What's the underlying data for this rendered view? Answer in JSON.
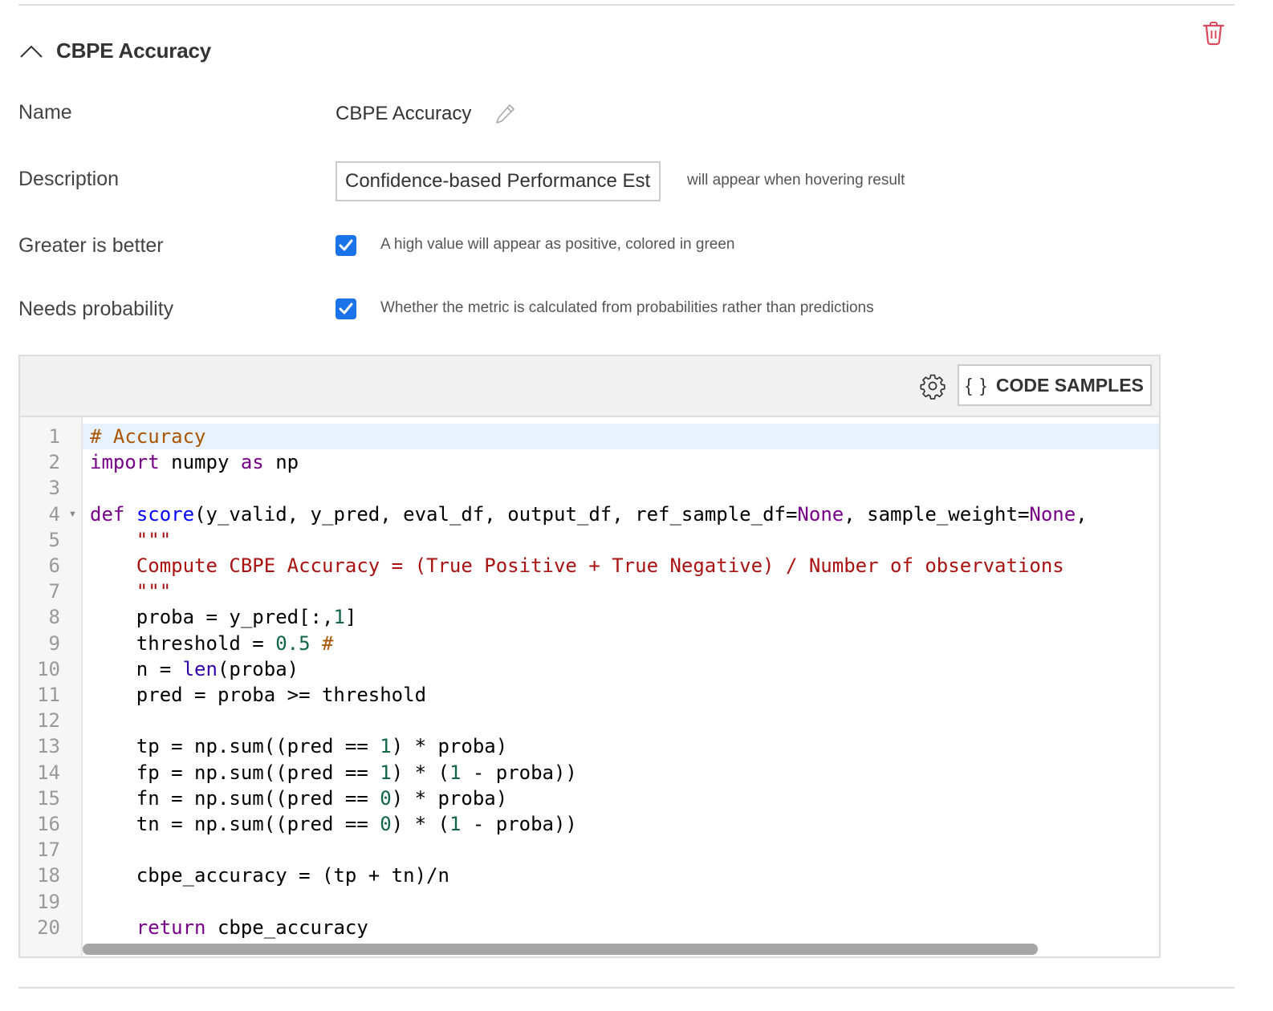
{
  "section": {
    "title": "CBPE Accuracy",
    "collapse_icon": "chevron-up-icon",
    "delete_icon": "trash-icon",
    "delete_color": "#d9485c"
  },
  "fields": {
    "name": {
      "label": "Name",
      "value": "CBPE Accuracy",
      "edit_icon": "pencil-icon"
    },
    "description": {
      "label": "Description",
      "value": "Confidence-based Performance Estimation",
      "hint": "will appear when hovering result"
    },
    "greater_is_better": {
      "label": "Greater is better",
      "checked": true,
      "hint": "A high value will appear as positive, colored in green"
    },
    "needs_probability": {
      "label": "Needs probability",
      "checked": true,
      "hint": "Whether the metric is calculated from probabilities rather than predictions"
    }
  },
  "accent_color": "#1a73e8",
  "editor": {
    "settings_icon": "gear-icon",
    "code_samples_icon": "{ }",
    "code_samples_label": "CODE SAMPLES",
    "active_line": 1,
    "fold_line": 4,
    "lines": [
      [
        [
          "comment",
          "# Accuracy"
        ]
      ],
      [
        [
          "keyword",
          "import"
        ],
        [
          "plain",
          " numpy "
        ],
        [
          "keyword",
          "as"
        ],
        [
          "plain",
          " np"
        ]
      ],
      [],
      [
        [
          "keyword",
          "def"
        ],
        [
          "plain",
          " "
        ],
        [
          "def",
          "score"
        ],
        [
          "plain",
          "(y_valid, y_pred, eval_df, output_df, ref_sample_df="
        ],
        [
          "keyword",
          "None"
        ],
        [
          "plain",
          ", sample_weight="
        ],
        [
          "keyword",
          "None"
        ],
        [
          "plain",
          ","
        ]
      ],
      [
        [
          "plain",
          "    "
        ],
        [
          "string",
          "\"\"\""
        ]
      ],
      [
        [
          "plain",
          "    "
        ],
        [
          "string",
          "Compute CBPE Accuracy = (True Positive + True Negative) / Number of observations"
        ]
      ],
      [
        [
          "plain",
          "    "
        ],
        [
          "string",
          "\"\"\""
        ]
      ],
      [
        [
          "plain",
          "    proba = y_pred[:,"
        ],
        [
          "number",
          "1"
        ],
        [
          "plain",
          "]"
        ]
      ],
      [
        [
          "plain",
          "    threshold = "
        ],
        [
          "number",
          "0.5"
        ],
        [
          "plain",
          " "
        ],
        [
          "comment",
          "#"
        ]
      ],
      [
        [
          "plain",
          "    n = "
        ],
        [
          "builtin",
          "len"
        ],
        [
          "plain",
          "(proba)"
        ]
      ],
      [
        [
          "plain",
          "    pred = proba >= threshold"
        ]
      ],
      [],
      [
        [
          "plain",
          "    tp = np.sum((pred == "
        ],
        [
          "number",
          "1"
        ],
        [
          "plain",
          ") * proba)"
        ]
      ],
      [
        [
          "plain",
          "    fp = np.sum((pred == "
        ],
        [
          "number",
          "1"
        ],
        [
          "plain",
          ") * ("
        ],
        [
          "number",
          "1"
        ],
        [
          "plain",
          " - proba))"
        ]
      ],
      [
        [
          "plain",
          "    fn = np.sum((pred == "
        ],
        [
          "number",
          "0"
        ],
        [
          "plain",
          ") * proba)"
        ]
      ],
      [
        [
          "plain",
          "    tn = np.sum((pred == "
        ],
        [
          "number",
          "0"
        ],
        [
          "plain",
          ") * ("
        ],
        [
          "number",
          "1"
        ],
        [
          "plain",
          " - proba))"
        ]
      ],
      [],
      [
        [
          "plain",
          "    cbpe_accuracy = (tp + tn)/n"
        ]
      ],
      [],
      [
        [
          "plain",
          "    "
        ],
        [
          "keyword",
          "return"
        ],
        [
          "plain",
          " cbpe_accuracy"
        ]
      ]
    ]
  }
}
